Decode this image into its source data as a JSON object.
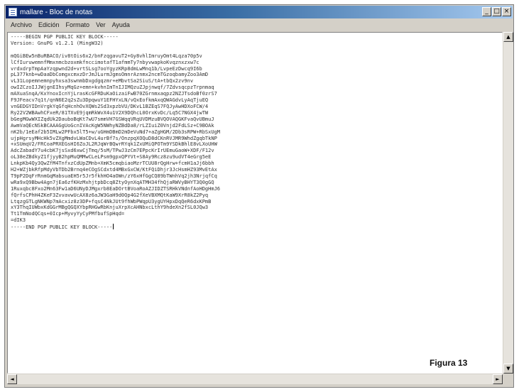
{
  "window": {
    "title": "mallare - Bloc de notas",
    "buttons": {
      "minimize": "_",
      "maximize": "□",
      "close": "×"
    }
  },
  "menu": [
    "Archivo",
    "Edición",
    "Formato",
    "Ver",
    "Ayuda"
  ],
  "editor": {
    "lines": [
      "-----BEGIN PGP PUBLIC KEY BLOCK-----",
      "Version: GnuPG v1.2.1 (MingW32)",
      "",
      "mQGiBEw5nBuRBACO/iv8tOis6x2/bnFzqgavuT2+Gy8vhlImruyOmt4Lqza70p5v",
      "lCfIuruwemnfMmxnmcbzoxmkfnccimotafT1afmmTy7nbyvwapkoKvqznxzxw7c",
      "vrdxdrpTmpAaYzqpwnd2d+vrtSLsg7ooYgyzKRp8dmLwMnq1b/LvpeEzDwcq9I6b",
      "pL377knb+wDaaDbComgxcmxzDrJmJLurmJgmsOmnrAznmx2ncmTGzoqbamyZoo3AmD",
      "vL31Lopemnemnpyhxsa3swnmbDxgdgqzmr+eMbvtSa2SiuS/tA+tbQx2zv9nv",
      "owIZCzoIJJWjgnEIhsyMqGz+emn+kvhnImTnIJIMQzuZJpjnwqf/7ZdvsqcpzTrpnmaq",
      "mAXuaSnqA/KxYnoxIcnYjLrasKcGFRDuKaOizaiFwB70ZGrnmxaqpz2NZJTsdoBf0zrS7",
      "F9JFeacv7q1t/qnN6E2q2sZu3DpqwuY1EFHYxLN/vQxEofkmAxqQWAGdvLyAqTjuEQ",
      "vnGEDGYIDnVrgkYqGfqHcnhOvXQWs2Sd3xpzbVU/DKvL1BZEqS7FQJyAwHDXoFCW/4",
      "Ry22V2WBAwhCFxeR/81TXvE9jqmRkWvX4u1V2X9DQhcL0OrxKvDc/Lq5C7NGX4jwTW",
      "bGegMGwWXIZqdUk2DauboBqKt7wU7smmVH7GSWqqVRqUVDMzuBVQOVAQGKFvaQvUBmuJ",
      "AwmVaQEcNSkBCAAAGgUoGcnIVAcKgW5NWhyNZBdDa8/rLZIuiZ0Vnjd2FdLSz+C9BOAk",
      "nK2b/1eEaf2b5IMLw2PFbx5lT5+w/uGHmDBmD2mDeVuNd7+aZgHGM/2Db3sRPW+RbSxUgM",
      "ujpHgrsyMHcHk5vZXgMmdvLWaCDvL4urBf7s/OnzpqXOQuD8dCKnRVJMR9WhdZgqbTkNP",
      "+xSUmqV2/FRCoaPRXEGsHI6ZoJL2RJqWrBQwrRYqk1ZxUMiQPOTm9YSDkBhlE8vLXoUHW",
      "AdcZabadY7u4cbK7jsSxd6xwCjTmq/5sM/TPwJ3zCm7EPpcKrIrUEmuGaoW+XDF/F12v",
      "oL38eZBdkyZ1fjyyB2hpMuQMMwCLeLPsm9gpxQPYVt+S8Ay9Rcz8zu9udVT4eGrg5eE",
      "LnkpKb4Qy3QwZfM4TnfxzCdUpZMnb+XmK5cmqbiaoMzrTCUU8rQgHrw+fcmH1aJj6bbh",
      "H2+WZjbkRfpMdyVbTDb2Brnq4eCOgSCdxtd4MBxGxCW/KtFQiDhjr3JcHsmHZ93MvEtAx",
      "T9pP2DqFrRnmGqMabsuaEH5r5Jr5fkhHO4aOWn/zY6xHfGgCQ89bTWnhVq2jh3NrjqfCq",
      "wRa9xQ9Bbw4Agn7jEa6zfKHzMxhjtpbDcq8ZtyOynXqATMH34fhQjaRWVyBHYT3Q0gGQ",
      "1Ruxqbc8Fxo2Mn63Fw1aD6UNyDJMgxrb8EaDOrtBVoaRoAZJIDZTSRHkVNdnfAoHDgHmJ6",
      "fQrfsCPhH4ZKeF3ZvvavwUcAX8z6aJW3GaH9d0Qp4G2fXeVBXMQtKaW9XrR8kZ2Pyq",
      "LtqzgGTLgNKWNp7mAcxiz8z3DP+fqsC4NkJUt9fhWbPWqpU3ygUYHpxDqQeR6dxKPmB",
      "xY3ThqIUWbxKdGGrMBgQGQXYbpRHGwRbKnjuXrpXcAHNbxcLthY9hdeXn2fSL0JQw3",
      "Tt1TmNodQCqs+0Icp+MyvyYyCyPMfbufSpHqd="
    ],
    "armor_checksum": "=dIK3",
    "end_line": "-----END PGP PUBLIC KEY BLOCK-----"
  },
  "scrollbar": {
    "up": "▲",
    "down": "▼",
    "left": "◄",
    "right": "►"
  },
  "caption": "Figura 13"
}
